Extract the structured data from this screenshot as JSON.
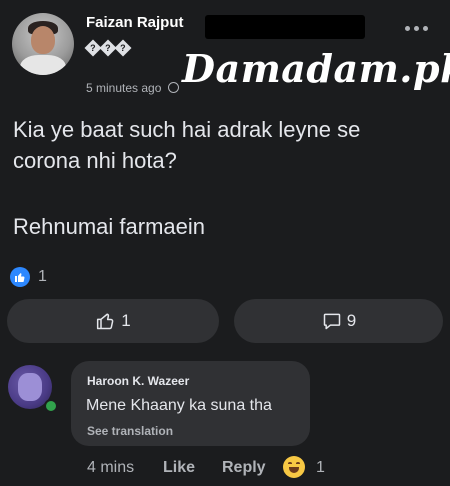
{
  "post": {
    "author": "Faizan Rajput",
    "author_suffix_glyphs": [
      "?",
      "?",
      "?"
    ],
    "time": "5 minutes ago",
    "watermark": "Damadam.pk",
    "text_line1": "Kia ye baat such hai adrak leyne se corona nhi hota?",
    "text_line2": "Rehnumai farmaein",
    "reaction_count": "1",
    "like_button_count": "1",
    "comment_button_count": "9"
  },
  "comment": {
    "author": "Haroon K. Wazeer",
    "text": "Mene Khaany ka suna tha",
    "see_translation": "See translation",
    "time": "4 mins",
    "like_label": "Like",
    "reply_label": "Reply",
    "reaction_count": "1"
  },
  "colors": {
    "background": "#1b1c1e",
    "bubble": "#303134",
    "like_blue": "#2d88ff",
    "online_green": "#31a24c",
    "haha_yellow": "#f7c844"
  },
  "icons": [
    "globe-icon",
    "more-icon",
    "like-reaction-icon",
    "thumbs-up-icon",
    "comment-icon",
    "haha-reaction-icon"
  ]
}
